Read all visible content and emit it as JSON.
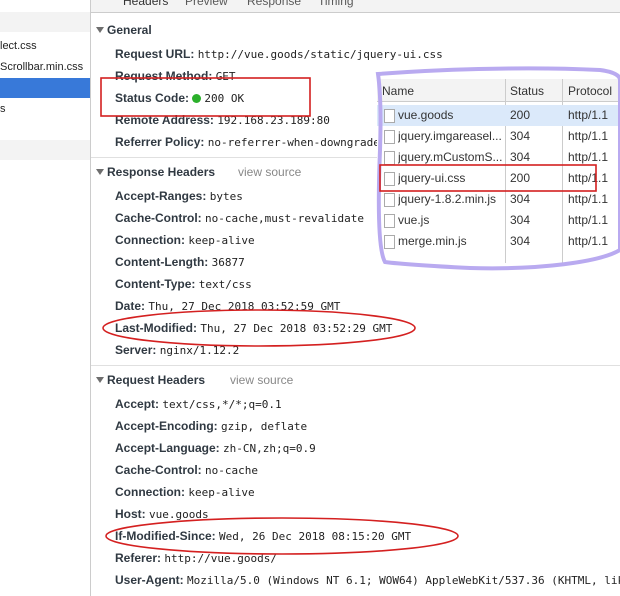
{
  "left_list": {
    "items": [
      "",
      "lect.css",
      "Scrollbar.min.css",
      "",
      "s",
      "",
      ""
    ]
  },
  "tabs": [
    "Headers",
    "Preview",
    "Response",
    "Timing"
  ],
  "general": {
    "title": "General",
    "rows": [
      {
        "key": "Request URL:",
        "value": "http://vue.goods/static/jquery-ui.css"
      },
      {
        "key": "Request Method:",
        "value": "GET"
      },
      {
        "key": "Status Code:",
        "value": "200 OK"
      },
      {
        "key": "Remote Address:",
        "value": "192.168.23.189:80"
      },
      {
        "key": "Referrer Policy:",
        "value": "no-referrer-when-downgrade"
      }
    ]
  },
  "response_headers": {
    "title": "Response Headers",
    "view_source": "view source",
    "rows": [
      {
        "key": "Accept-Ranges:",
        "value": "bytes"
      },
      {
        "key": "Cache-Control:",
        "value": "no-cache,must-revalidate"
      },
      {
        "key": "Connection:",
        "value": "keep-alive"
      },
      {
        "key": "Content-Length:",
        "value": "36877"
      },
      {
        "key": "Content-Type:",
        "value": "text/css"
      },
      {
        "key": "Date:",
        "value": "Thu, 27 Dec 2018 03:52:59 GMT"
      },
      {
        "key": "Last-Modified:",
        "value": "Thu, 27 Dec 2018 03:52:29 GMT"
      },
      {
        "key": "Server:",
        "value": "nginx/1.12.2"
      }
    ]
  },
  "request_headers": {
    "title": "Request Headers",
    "view_source": "view source",
    "rows": [
      {
        "key": "Accept:",
        "value": "text/css,*/*;q=0.1"
      },
      {
        "key": "Accept-Encoding:",
        "value": "gzip, deflate"
      },
      {
        "key": "Accept-Language:",
        "value": "zh-CN,zh;q=0.9"
      },
      {
        "key": "Cache-Control:",
        "value": "no-cache"
      },
      {
        "key": "Connection:",
        "value": "keep-alive"
      },
      {
        "key": "Host:",
        "value": "vue.goods"
      },
      {
        "key": "If-Modified-Since:",
        "value": "Wed, 26 Dec 2018 08:15:20 GMT"
      },
      {
        "key": "Referer:",
        "value": "http://vue.goods/"
      },
      {
        "key": "User-Agent:",
        "value": "Mozilla/5.0 (Windows NT 6.1; WOW64) AppleWebKit/537.36 (KHTML, lik"
      }
    ]
  },
  "network_table": {
    "columns": [
      "Name",
      "Status",
      "Protocol"
    ],
    "rows": [
      {
        "name": "vue.goods",
        "status": "200",
        "protocol": "http/1.1"
      },
      {
        "name": "jquery.imgareasel...",
        "status": "304",
        "protocol": "http/1.1"
      },
      {
        "name": "jquery.mCustomS...",
        "status": "304",
        "protocol": "http/1.1"
      },
      {
        "name": "jquery-ui.css",
        "status": "200",
        "protocol": "http/1.1"
      },
      {
        "name": "jquery-1.8.2.min.js",
        "status": "304",
        "protocol": "http/1.1"
      },
      {
        "name": "vue.js",
        "status": "304",
        "protocol": "http/1.1"
      },
      {
        "name": "merge.min.js",
        "status": "304",
        "protocol": "http/1.1"
      }
    ]
  },
  "colors": {
    "annotation_red": "#d42020",
    "annotation_purple": "#b9aaf0",
    "selection_blue": "#3879d9",
    "status_green": "#2bb02b"
  },
  "icons": [
    "expand-triangle-icon",
    "status-dot-icon",
    "file-icon"
  ]
}
